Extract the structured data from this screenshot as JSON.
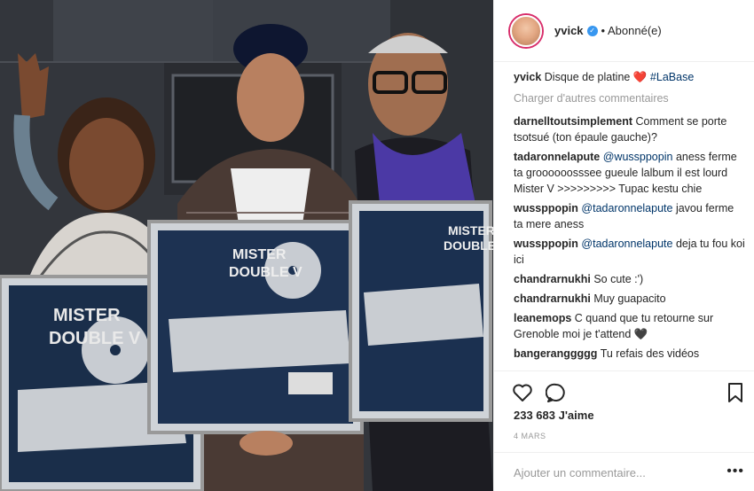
{
  "post": {
    "username": "yvick",
    "follow_status": "Abonné(e)",
    "caption_user": "yvick",
    "caption_text": "Disque de platine",
    "caption_emoji": "❤️",
    "caption_hashtag": "#LaBase",
    "load_more": "Charger d'autres commentaires",
    "likes": "233 683 J'aime",
    "date": "4 MARS",
    "comment_placeholder": "Ajouter un commentaire...",
    "more": "•••"
  },
  "artwork": {
    "album_title_line1": "MISTER",
    "album_title_line2": "DOUBLE V"
  },
  "comments": [
    {
      "user": "darnelltoutsimplement",
      "text": "Comment se porte tsotsué (ton épaule gauche)?"
    },
    {
      "user": "tadaronnelapute",
      "mention": "@wussppopin",
      "text": "aness ferme ta groooooosssee gueule lalbum il est lourd Mister V >>>>>>>>> Tupac kestu chie"
    },
    {
      "user": "wussppopin",
      "mention": "@tadaronnelapute",
      "text": "javou ferme ta mere aness"
    },
    {
      "user": "wussppopin",
      "mention": "@tadaronnelapute",
      "text": "deja tu fou koi ici"
    },
    {
      "user": "chandrarnukhi",
      "text": "So cute :')"
    },
    {
      "user": "chandrarnukhi",
      "text": "Muy guapacito"
    },
    {
      "user": "leanemops",
      "text": "C quand que tu retourne sur Grenoble moi je t'attend 🖤"
    },
    {
      "user": "bangeranggggg",
      "text": "Tu refais des vidéos"
    }
  ],
  "icons": {
    "like": "heart-outline-icon",
    "comment": "speech-bubble-icon",
    "save": "bookmark-icon",
    "verified": "verified-badge-icon"
  },
  "colors": {
    "accent_link": "#003569",
    "verified_blue": "#3897f0",
    "muted_text": "#999999",
    "heart_red": "#ed4956"
  }
}
